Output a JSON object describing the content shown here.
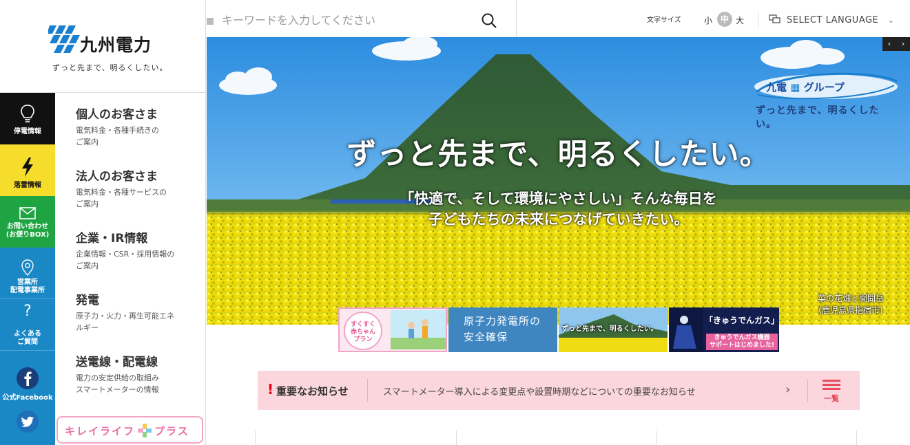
{
  "brand": {
    "name": "九州電力",
    "slogan": "ずっと先まで、明るくしたい。",
    "accent": "#1b88c6"
  },
  "side_icons": [
    {
      "label": "停電情報",
      "icon": "lightbulb-icon",
      "color": "#111111"
    },
    {
      "label": "落雷情報",
      "icon": "lightning-icon",
      "color": "#f6dd2b"
    },
    {
      "label": "お問い合わせ\n(お便りBOX)",
      "icon": "mail-icon",
      "color": "#1ea442"
    },
    {
      "label": "営業所\n配電事業所",
      "icon": "location-pin-icon",
      "color": "#1b88c6"
    },
    {
      "label": "よくある\nご質問",
      "icon": "question-icon",
      "color": "#1b88c6"
    },
    {
      "label": "公式Facebook",
      "icon": "facebook-icon",
      "color": "#1b88c6"
    },
    {
      "label": "",
      "icon": "twitter-icon",
      "color": "#1b88c6"
    }
  ],
  "menu": [
    {
      "title": "個人のお客さま",
      "sub": "電気料金・各種手続きの\nご案内"
    },
    {
      "title": "法人のお客さま",
      "sub": "電気料金・各種サービスの\nご案内"
    },
    {
      "title": "企業・IR情報",
      "sub": "企業情報・CSR・採用情報の\nご案内"
    },
    {
      "title": "発電",
      "sub": "原子力・火力・再生可能エネ\nルギー"
    },
    {
      "title": "送電線・配電線",
      "sub": "電力の安定供給の取組み\nスマートメーターの情報"
    }
  ],
  "kirei": {
    "label_left": "キレイライフ",
    "label_right": "プラス"
  },
  "search": {
    "placeholder": "キーワードを入力してください"
  },
  "font_size": {
    "label": "文字サイズ",
    "small": "小",
    "medium": "中",
    "large": "大",
    "selected": "中"
  },
  "language": {
    "label": "SELECT LANGUAGE"
  },
  "hero": {
    "headline": "ずっと先まで、明るくしたい。",
    "sub_line1": "「快適で、そして環境にやさしい」そんな毎日を",
    "sub_line2": "子どもたちの未来につなげていきたい。",
    "caption_line1": "菜の花畑と開聞岳",
    "caption_line2": "(鹿児島県指宿市)",
    "group_name_left": "九電",
    "group_name_right": "グループ",
    "group_slogan": "ずっと先まで、明るくしたい。",
    "prev": "‹",
    "next": "›"
  },
  "banners": {
    "baby_title": "すくすく\n赤ちゃん\nプラン",
    "nuclear_line1": "原子力発電所の",
    "nuclear_line2": "安全確保",
    "slogan": "ずっと先まで、明るくしたい。",
    "gas_title": "「きゅうでんガス」",
    "gas_sub": "きゅうでんガス機器\nサポートはじめました!"
  },
  "notice": {
    "title": "重要なお知らせ",
    "message": "スマートメーター導入による変更点や設置時期などについての重要なお知らせ",
    "list_label": "一覧"
  }
}
